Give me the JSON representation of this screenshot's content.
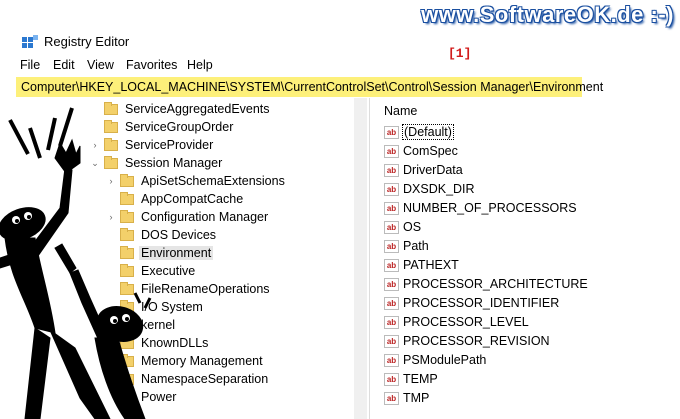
{
  "banner": {
    "text": "www.SoftwareOK.de :-)"
  },
  "window": {
    "title": "Registry Editor",
    "marker": "[1]"
  },
  "menu": [
    "File",
    "Edit",
    "View",
    "Favorites",
    "Help"
  ],
  "address": {
    "path": "Computer\\HKEY_LOCAL_MACHINE\\SYSTEM\\CurrentControlSet\\Control\\Session Manager\\Environment"
  },
  "tree": [
    {
      "label": "ServiceAggregatedEvents",
      "level": 1
    },
    {
      "label": "ServiceGroupOrder",
      "level": 1
    },
    {
      "label": "ServiceProvider",
      "level": 1,
      "chevron": "right"
    },
    {
      "label": "Session Manager",
      "level": 1,
      "chevron": "down"
    },
    {
      "label": "ApiSetSchemaExtensions",
      "level": 2,
      "chevron": "right"
    },
    {
      "label": "AppCompatCache",
      "level": 2
    },
    {
      "label": "Configuration Manager",
      "level": 2,
      "chevron": "right"
    },
    {
      "label": "DOS Devices",
      "level": 2
    },
    {
      "label": "Environment",
      "level": 2,
      "selected": true
    },
    {
      "label": "Executive",
      "level": 2
    },
    {
      "label": "FileRenameOperations",
      "level": 2
    },
    {
      "label": "I/O System",
      "level": 2
    },
    {
      "label": "kernel",
      "level": 2
    },
    {
      "label": "KnownDLLs",
      "level": 2
    },
    {
      "label": "Memory Management",
      "level": 2,
      "chevron": "right"
    },
    {
      "label": "NamespaceSeparation",
      "level": 2
    },
    {
      "label": "Power",
      "level": 2
    }
  ],
  "values_header": "Name",
  "values": [
    "(Default)",
    "ComSpec",
    "DriverData",
    "DXSDK_DIR",
    "NUMBER_OF_PROCESSORS",
    "OS",
    "Path",
    "PATHEXT",
    "PROCESSOR_ARCHITECTURE",
    "PROCESSOR_IDENTIFIER",
    "PROCESSOR_LEVEL",
    "PROCESSOR_REVISION",
    "PSModulePath",
    "TEMP",
    "TMP"
  ],
  "value_icon": "ab",
  "colors": {
    "address_highlight": "#fdf07a",
    "banner": "#1a4fa0",
    "marker": "#d21a1a"
  }
}
